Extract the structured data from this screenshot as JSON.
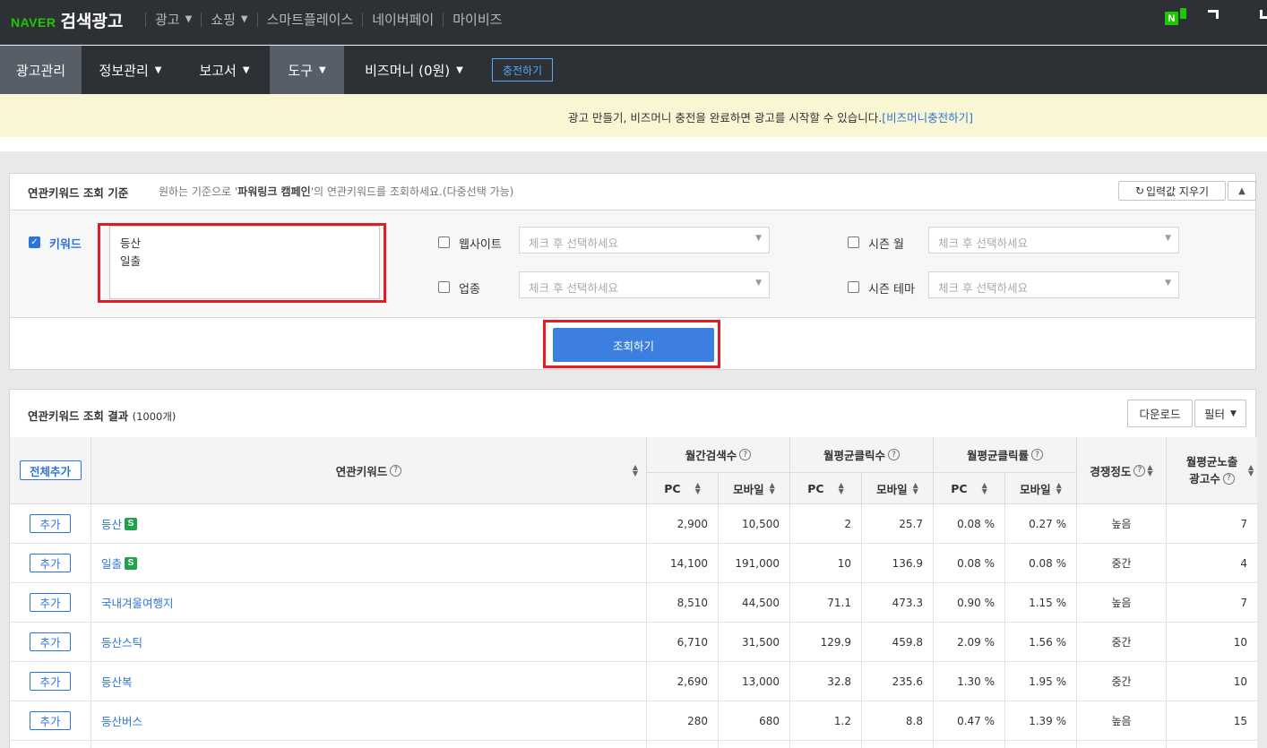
{
  "brand": {
    "naver": "NAVER",
    "title": "검색광고"
  },
  "topnav": [
    {
      "label": "광고",
      "chevron": true
    },
    {
      "label": "쇼핑",
      "chevron": true
    },
    {
      "label": "스마트플레이스",
      "chevron": false
    },
    {
      "label": "네이버페이",
      "chevron": false
    },
    {
      "label": "마이비즈",
      "chevron": false
    }
  ],
  "top_right": {
    "n_icon": "N"
  },
  "menubar": {
    "items": [
      {
        "label": "광고관리"
      },
      {
        "label": "정보관리"
      },
      {
        "label": "보고서"
      },
      {
        "label": "도구"
      },
      {
        "label": "비즈머니 (0원)"
      }
    ],
    "charge_button": "충전하기"
  },
  "notice": {
    "message": "광고 만들기, 비즈머니 충전을 완료하면 광고를 시작할 수 있습니다.",
    "link": "[비즈머니충전하기]"
  },
  "criteria": {
    "title": "연관키워드 조회 기준",
    "desc_prefix": "원하는 기준으로 '",
    "desc_bold": "파워링크 캠페인",
    "desc_suffix": "'의 연관키워드를 조회하세요.(다중선택 가능)",
    "reset_button": "입력값 지우기",
    "keyword_label": "키워드",
    "keywords": [
      "등산",
      "일출"
    ],
    "website_label": "웹사이트",
    "industry_label": "업종",
    "season_month_label": "시즌 월",
    "season_theme_label": "시즌 테마",
    "select_placeholder": "체크 후 선택하세요",
    "search_button": "조회하기"
  },
  "results": {
    "title": "연관키워드 조회 결과",
    "count": "(1000개)",
    "download_button": "다운로드",
    "filter_button": "필터",
    "headers": {
      "add_all": "전체추가",
      "keyword": "연관키워드",
      "monthly_search": "월간검색수",
      "monthly_clicks": "월평균클릭수",
      "monthly_ctr": "월평균클릭률",
      "pc": "PC",
      "mobile": "모바일",
      "competition": "경쟁정도",
      "ads_line1": "월평균노출",
      "ads_line2": "광고수"
    },
    "add_label": "추가",
    "rows": [
      {
        "keyword": "등산",
        "badge": "S",
        "pc_search": "2,900",
        "mo_search": "10,500",
        "pc_click": "2",
        "mo_click": "25.7",
        "pc_ctr": "0.08 %",
        "mo_ctr": "0.27 %",
        "competition": "높음",
        "ads": "7"
      },
      {
        "keyword": "일출",
        "badge": "S",
        "pc_search": "14,100",
        "mo_search": "191,000",
        "pc_click": "10",
        "mo_click": "136.9",
        "pc_ctr": "0.08 %",
        "mo_ctr": "0.08 %",
        "competition": "중간",
        "ads": "4"
      },
      {
        "keyword": "국내겨울여행지",
        "badge": "",
        "pc_search": "8,510",
        "mo_search": "44,500",
        "pc_click": "71.1",
        "mo_click": "473.3",
        "pc_ctr": "0.90 %",
        "mo_ctr": "1.15 %",
        "competition": "높음",
        "ads": "7"
      },
      {
        "keyword": "등산스틱",
        "badge": "",
        "pc_search": "6,710",
        "mo_search": "31,500",
        "pc_click": "129.9",
        "mo_click": "459.8",
        "pc_ctr": "2.09 %",
        "mo_ctr": "1.56 %",
        "competition": "중간",
        "ads": "10"
      },
      {
        "keyword": "등산복",
        "badge": "",
        "pc_search": "2,690",
        "mo_search": "13,000",
        "pc_click": "32.8",
        "mo_click": "235.6",
        "pc_ctr": "1.30 %",
        "mo_ctr": "1.95 %",
        "competition": "중간",
        "ads": "10"
      },
      {
        "keyword": "등산버스",
        "badge": "",
        "pc_search": "280",
        "mo_search": "680",
        "pc_click": "1.2",
        "mo_click": "8.8",
        "pc_ctr": "0.47 %",
        "mo_ctr": "1.39 %",
        "competition": "높음",
        "ads": "15"
      }
    ]
  }
}
